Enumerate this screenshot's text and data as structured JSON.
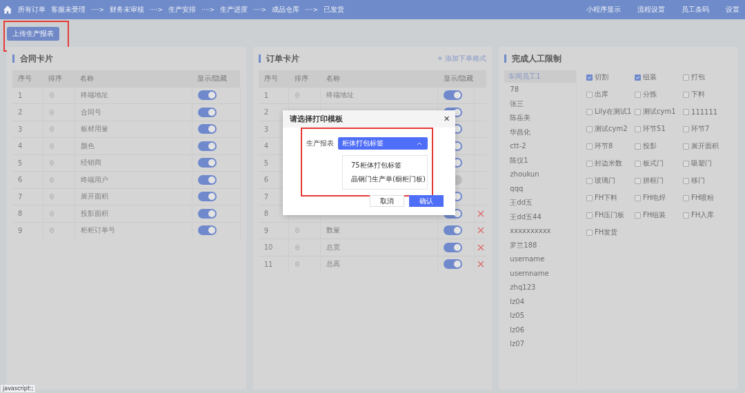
{
  "nav": {
    "home": "所有订单",
    "steps": [
      {
        "label": "客服未受理"
      },
      {
        "arrow": "····>",
        "label": "财务未审核"
      },
      {
        "arrow": "····>",
        "label": "生产安排"
      },
      {
        "arrow": "····>",
        "label": "生产进度"
      },
      {
        "arrow": "····>",
        "label": "成品仓库"
      },
      {
        "arrow": "····>",
        "label": "已发货"
      }
    ],
    "right_links": [
      "小程序显示",
      "流程设置",
      "员工条码",
      "设置"
    ]
  },
  "upload_button": {
    "label": "上传生产报表",
    "highlighted": true
  },
  "contract_card": {
    "title": "合同卡片",
    "columns": [
      "序号",
      "排序",
      "名称",
      "显示/隐藏"
    ],
    "rows": [
      {
        "no": "1",
        "name": "终端地址",
        "on": true
      },
      {
        "no": "2",
        "name": "合同号",
        "on": true
      },
      {
        "no": "3",
        "name": "板材用量",
        "on": true
      },
      {
        "no": "4",
        "name": "颜色",
        "on": true
      },
      {
        "no": "5",
        "name": "经销商",
        "on": true
      },
      {
        "no": "6",
        "name": "终端用户",
        "on": true
      },
      {
        "no": "7",
        "name": "展开面积",
        "on": true
      },
      {
        "no": "8",
        "name": "投影面积",
        "on": true
      },
      {
        "no": "9",
        "name": "柜柜订单号",
        "on": true
      }
    ]
  },
  "order_card": {
    "title": "订单卡片",
    "add_link": "+ 添加下单格式",
    "columns": [
      "序号",
      "排序",
      "名称",
      "显示/隐藏"
    ],
    "rows": [
      {
        "no": "1",
        "name": "终端地址",
        "on": true,
        "deletable": false
      },
      {
        "no": "2",
        "on": true,
        "deletable": false
      },
      {
        "no": "3",
        "on": true,
        "deletable": false
      },
      {
        "no": "4",
        "on": true,
        "deletable": false
      },
      {
        "no": "5",
        "on": true,
        "deletable": false
      },
      {
        "no": "6",
        "on": false,
        "deletable": false
      },
      {
        "no": "7",
        "on": true,
        "deletable": false
      },
      {
        "no": "8",
        "on": true,
        "deletable": true
      },
      {
        "no": "9",
        "name": "数量",
        "on": true,
        "deletable": true
      },
      {
        "no": "10",
        "name": "总宽",
        "on": true,
        "deletable": true
      },
      {
        "no": "11",
        "name": "总高",
        "on": true,
        "deletable": true
      }
    ]
  },
  "labor_limit": {
    "title": "完成人工限制",
    "employees": [
      {
        "name": "车间员工1",
        "selected": true
      },
      {
        "name": "78",
        "selected": false
      },
      {
        "name": "张三",
        "selected": false
      },
      {
        "name": "陈岳美",
        "selected": false
      },
      {
        "name": "华昌化",
        "selected": false
      },
      {
        "name": "ctt-2",
        "selected": false
      },
      {
        "name": "陈仪1",
        "selected": false
      },
      {
        "name": "zhoukun",
        "selected": false
      },
      {
        "name": "qqq",
        "selected": false
      },
      {
        "name": "王dd五",
        "selected": false
      },
      {
        "name": "王dd五44",
        "selected": false
      },
      {
        "name": "xxxxxxxxxx",
        "selected": false
      },
      {
        "name": "罗兰188",
        "selected": false
      },
      {
        "name": "username",
        "selected": false
      },
      {
        "name": "usernname",
        "selected": false
      },
      {
        "name": "zhq123",
        "selected": false
      },
      {
        "name": "lz04",
        "selected": false
      },
      {
        "name": "lz05",
        "selected": false
      },
      {
        "name": "lz06",
        "selected": false
      },
      {
        "name": "lz07",
        "selected": false
      }
    ],
    "processes": [
      {
        "label": "切割",
        "checked": true
      },
      {
        "label": "组装",
        "checked": true
      },
      {
        "label": "打包",
        "checked": false
      },
      {
        "label": "出库",
        "checked": false
      },
      {
        "label": "分拣",
        "checked": false
      },
      {
        "label": "下料",
        "checked": false
      },
      {
        "label": "Lily在测试1",
        "checked": false
      },
      {
        "label": "测试cym1",
        "checked": false
      },
      {
        "label": "111111",
        "checked": false
      },
      {
        "label": "测试cym2",
        "checked": false
      },
      {
        "label": "环节51",
        "checked": false
      },
      {
        "label": "环节7",
        "checked": false
      },
      {
        "label": "环节8",
        "checked": false
      },
      {
        "label": "投影",
        "checked": false
      },
      {
        "label": "展开面积",
        "checked": false
      },
      {
        "label": "封边米数",
        "checked": false
      },
      {
        "label": "板式门",
        "checked": false
      },
      {
        "label": "吸塑门",
        "checked": false
      },
      {
        "label": "玻璃门",
        "checked": false
      },
      {
        "label": "拼框门",
        "checked": false
      },
      {
        "label": "移门",
        "checked": false
      },
      {
        "label": "FH下料",
        "checked": false
      },
      {
        "label": "FH电焊",
        "checked": false
      },
      {
        "label": "FH喷粉",
        "checked": false
      },
      {
        "label": "FH压门板",
        "checked": false
      },
      {
        "label": "FH组装",
        "checked": false
      },
      {
        "label": "FH入库",
        "checked": false
      },
      {
        "label": "FH发货",
        "checked": false
      }
    ]
  },
  "dialog": {
    "title": "请选择打印模板",
    "close": "✕",
    "field_label": "生产报表",
    "value": "柜体打包标签",
    "expanded": true,
    "options": [
      "75柜体打包标签",
      "晶钢门生产单(橱柜门板)"
    ],
    "highlighted": true,
    "buttons": [
      {
        "label": "取消",
        "kind": "secondary"
      },
      {
        "label": "确认",
        "kind": "primary"
      }
    ]
  },
  "status_bar": "javascript:;"
}
